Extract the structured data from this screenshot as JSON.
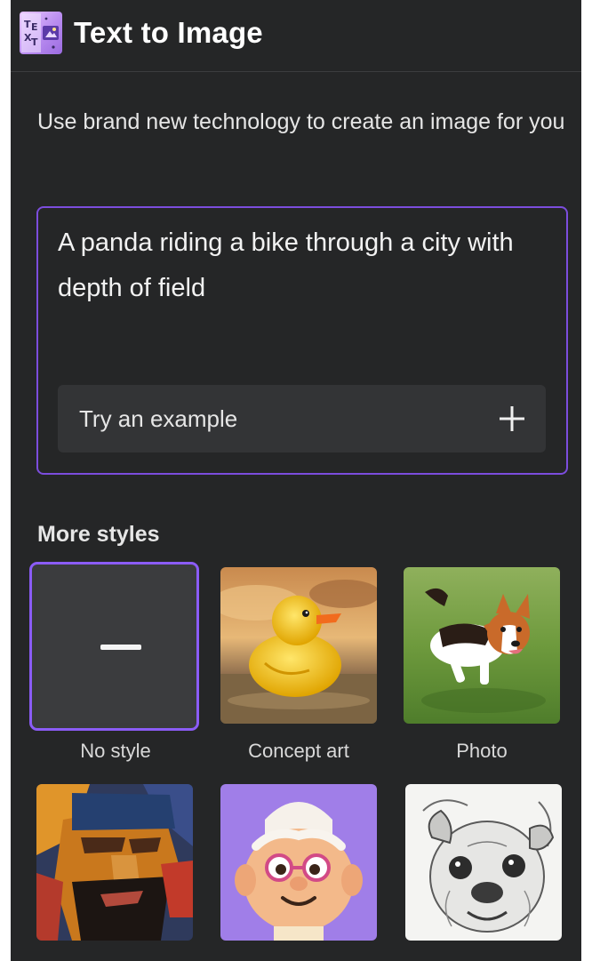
{
  "header": {
    "app_icon": "text-to-image-app-icon",
    "app_icon_letters": "TEXT",
    "title": "Text to Image"
  },
  "description": "Use brand new technology to create an image for you",
  "prompt": {
    "value": "A panda riding a bike through a city with depth of field",
    "try_example_label": "Try an example",
    "try_example_icon": "plus-icon"
  },
  "styles": {
    "section_title": "More styles",
    "selected": "No style",
    "accent_color": "#8b5cf6",
    "items": [
      {
        "label": "No style",
        "icon": "dash-icon"
      },
      {
        "label": "Concept art",
        "image": "rubber-duck-concept-art"
      },
      {
        "label": "Photo",
        "image": "running-corgi-photo"
      },
      {
        "label": "",
        "image": "painted-man-portrait"
      },
      {
        "label": "",
        "image": "3d-cartoon-character"
      },
      {
        "label": "",
        "image": "pencil-sketch-pug"
      }
    ]
  }
}
